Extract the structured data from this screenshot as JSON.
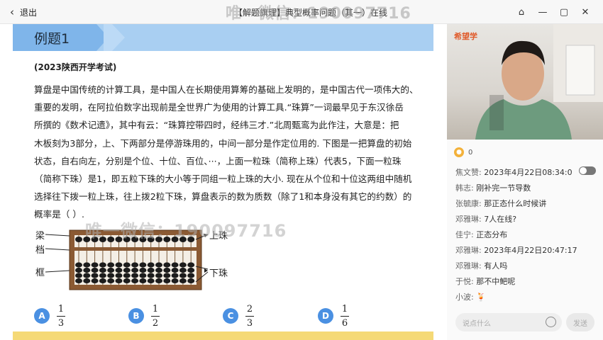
{
  "window": {
    "back_label": "退出",
    "title": "【解题旗理】典型概率问题（其一）在线",
    "watermark": "唯一微信：190097716"
  },
  "question": {
    "heading": "例题1",
    "source": "(2023陕西开学考试)",
    "lines": [
      "算盘是中国传统的计算工具，是中国人在长期使用算筹的基础上发明的，是中国古代一项伟大的、",
      "重要的发明，在阿拉伯数字出现前是全世界广为使用的计算工具.“珠算”一词最早见于东汉徐岳",
      "所撰的《数术记遗》，其中有云：“珠算控带四时，经纬三才.”北周甄鸾为此作注，大意是：把",
      "木板刻为3部分，上、下两部分是停游珠用的，中间一部分是作定位用的. 下图是一把算盘的初始",
      "状态，自右向左，分别是个位、十位、百位、···，上面一粒珠（简称上珠）代表5，下面一粒珠",
      "（简称下珠）是1，即五粒下珠的大小等于同组一粒上珠的大小. 现在从个位和十位这两组中随机",
      "选择往下拨一粒上珠，往上拨2粒下珠，算盘表示的数为质数（除了1和本身没有其它的约数）的",
      "概率是（      ）."
    ],
    "abacus_labels": {
      "beam": "梁",
      "rod": "档",
      "frame": "框",
      "upper_bead": "上珠",
      "lower_bead": "下珠"
    },
    "options": [
      {
        "letter": "A",
        "num": "1",
        "den": "3"
      },
      {
        "letter": "B",
        "num": "1",
        "den": "2"
      },
      {
        "letter": "C",
        "num": "2",
        "den": "3"
      },
      {
        "letter": "D",
        "num": "1",
        "den": "6"
      }
    ]
  },
  "side": {
    "brand": "希望学",
    "likes": "0",
    "messages": [
      {
        "name": "焦文赞:",
        "text": "2023年4月22日08:34:0"
      },
      {
        "name": "韩志:",
        "text": "刚补完一节导数"
      },
      {
        "name": "张毓康:",
        "text": "那正态什么时候讲"
      },
      {
        "name": "邓雅琳:",
        "text": "7人在线?"
      },
      {
        "name": "佳宁:",
        "text": "正态分布"
      },
      {
        "name": "邓雅琳:",
        "text": "2023年4月22日20:47:17"
      },
      {
        "name": "邓雅琳:",
        "text": "有人吗"
      },
      {
        "name": "于悦:",
        "text": "那不中鲃呢"
      },
      {
        "name": "小波:",
        "text": "🍹"
      }
    ],
    "input_placeholder": "说点什么",
    "send_label": "发送"
  },
  "colors": {
    "banner": "#a9cff2",
    "banner_tab": "#7fb5ea",
    "option_badge": "#4a90e2",
    "footer_bar": "#f5d976"
  }
}
